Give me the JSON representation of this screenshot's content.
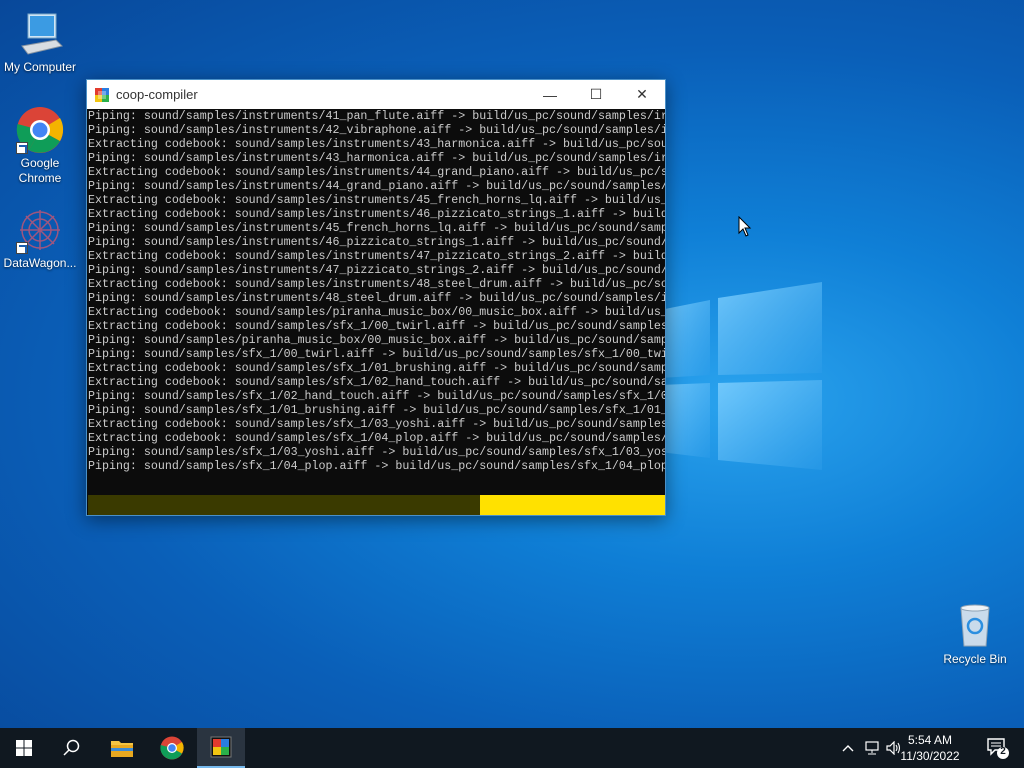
{
  "desktop": {
    "icons": [
      {
        "label": "My Computer"
      },
      {
        "label": "Google Chrome"
      },
      {
        "label": "DataWagon..."
      },
      {
        "label": "Recycle Bin"
      }
    ]
  },
  "window": {
    "title": "coop-compiler",
    "minimize_glyph": "—",
    "maximize_glyph": "☐",
    "close_glyph": "✕",
    "lines": [
      "Piping: sound/samples/instruments/41_pan_flute.aiff -> build/us_pc/sound/samples/ir",
      "Piping: sound/samples/instruments/42_vibraphone.aiff -> build/us_pc/sound/samples/i",
      "Extracting codebook: sound/samples/instruments/43_harmonica.aiff -> build/us_pc/sou",
      "Piping: sound/samples/instruments/43_harmonica.aiff -> build/us_pc/sound/samples/ir",
      "Extracting codebook: sound/samples/instruments/44_grand_piano.aiff -> build/us_pc/s",
      "Piping: sound/samples/instruments/44_grand_piano.aiff -> build/us_pc/sound/samples/",
      "Extracting codebook: sound/samples/instruments/45_french_horns_lq.aiff -> build/us_",
      "Extracting codebook: sound/samples/instruments/46_pizzicato_strings_1.aiff -> build",
      "Piping: sound/samples/instruments/45_french_horns_lq.aiff -> build/us_pc/sound/samp",
      "Piping: sound/samples/instruments/46_pizzicato_strings_1.aiff -> build/us_pc/sound/",
      "Extracting codebook: sound/samples/instruments/47_pizzicato_strings_2.aiff -> build",
      "Piping: sound/samples/instruments/47_pizzicato_strings_2.aiff -> build/us_pc/sound/",
      "Extracting codebook: sound/samples/instruments/48_steel_drum.aiff -> build/us_pc/so",
      "Piping: sound/samples/instruments/48_steel_drum.aiff -> build/us_pc/sound/samples/i",
      "Extracting codebook: sound/samples/piranha_music_box/00_music_box.aiff -> build/us_",
      "Extracting codebook: sound/samples/sfx_1/00_twirl.aiff -> build/us_pc/sound/samples",
      "Piping: sound/samples/piranha_music_box/00_music_box.aiff -> build/us_pc/sound/samp",
      "Piping: sound/samples/sfx_1/00_twirl.aiff -> build/us_pc/sound/samples/sfx_1/00_twi",
      "Extracting codebook: sound/samples/sfx_1/01_brushing.aiff -> build/us_pc/sound/samp",
      "Extracting codebook: sound/samples/sfx_1/02_hand_touch.aiff -> build/us_pc/sound/sa",
      "Piping: sound/samples/sfx_1/02_hand_touch.aiff -> build/us_pc/sound/samples/sfx_1/0",
      "Piping: sound/samples/sfx_1/01_brushing.aiff -> build/us_pc/sound/samples/sfx_1/01_",
      "Extracting codebook: sound/samples/sfx_1/03_yoshi.aiff -> build/us_pc/sound/samples",
      "Extracting codebook: sound/samples/sfx_1/04_plop.aiff -> build/us_pc/sound/samples/",
      "Piping: sound/samples/sfx_1/03_yoshi.aiff -> build/us_pc/sound/samples/sfx_1/03_yos",
      "Piping: sound/samples/sfx_1/04_plop.aiff -> build/us_pc/sound/samples/sfx_1/04_plop"
    ],
    "progress_remaining_fraction": 0.32,
    "colors": {
      "progress_fill": "#ffe100",
      "progress_track": "#3a3a00",
      "console_bg": "#0c0c0c",
      "console_text": "#cccccc"
    }
  },
  "taskbar": {
    "start_icon": "windows-logo-icon",
    "search_icon": "search-icon",
    "apps": [
      "file-explorer-icon",
      "chrome-icon",
      "coop-compiler-icon"
    ],
    "tray": {
      "time": "5:54 AM",
      "date": "11/30/2022",
      "notification_count": "2"
    }
  }
}
